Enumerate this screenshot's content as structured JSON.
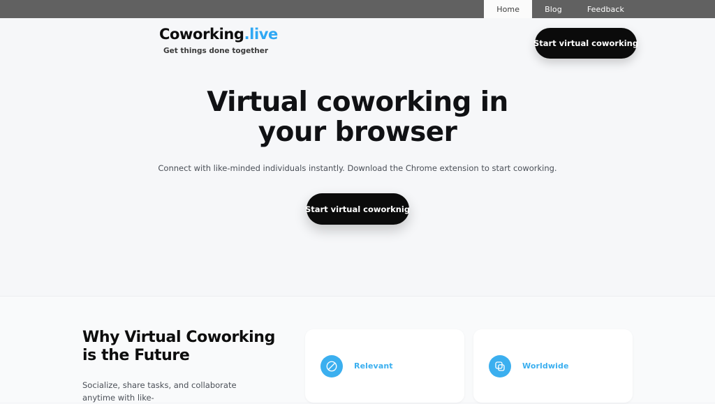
{
  "browser": {
    "tabs": [
      {
        "label": "Home",
        "active": true
      },
      {
        "label": "Blog",
        "active": false
      },
      {
        "label": "Feedback",
        "active": false
      }
    ]
  },
  "header": {
    "brand_primary": "Coworking",
    "brand_accent": ".live",
    "tagline": "Get things done together",
    "cta_label": "Start virtual coworking"
  },
  "hero": {
    "title": "Virtual coworking in your browser",
    "subtitle": "Connect with like-minded individuals instantly. Download the Chrome extension to start coworking.",
    "cta_label": "Start virtual coworknig"
  },
  "features": {
    "heading": "Why Virtual Coworking is the Future",
    "body": "Socialize, share tasks, and collaborate anytime with like-",
    "cards": [
      {
        "label": "Relevant",
        "icon": "compass-icon"
      },
      {
        "label": "Worldwide",
        "icon": "layers-icon"
      }
    ]
  },
  "colors": {
    "accent": "#3bafef",
    "brand_accent": "#2fa8f4",
    "cta_bg": "#0b0b0b",
    "chrome_bg": "#616161",
    "page_bg": "#f6f7f9"
  }
}
